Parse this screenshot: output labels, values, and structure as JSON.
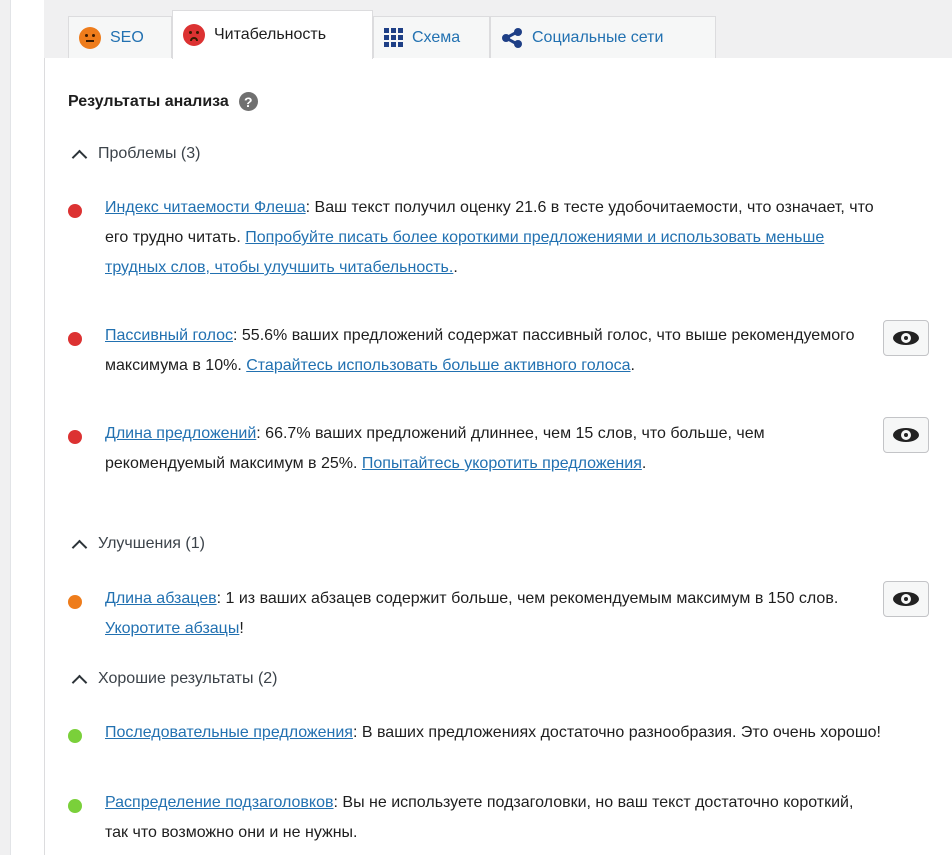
{
  "tabs": [
    {
      "label": "SEO",
      "icon": "orange-face-icon"
    },
    {
      "label": "Читабельность",
      "icon": "sad-red-face-icon"
    },
    {
      "label": "Схема",
      "icon": "grid-icon"
    },
    {
      "label": "Социальные сети",
      "icon": "share-icon"
    }
  ],
  "analysis": {
    "heading": "Результаты анализа",
    "help_icon": "?",
    "groups": {
      "problems": {
        "title": "Проблемы (3)",
        "items": [
          {
            "link": "Индекс читаемости Флеша",
            "text1": ": Ваш текст получил оценку 21.6 в тесте удобочитаемости, что означает, что его трудно читать. ",
            "link2": "Попробуйте писать более короткими предложениями и использовать меньше трудных слов, чтобы улучшить читабельность.",
            "text2": "."
          },
          {
            "link": "Пассивный голос",
            "text1": ": 55.6% ваших предложений содержат пассивный голос, что выше рекомендуемого максимума в 10%. ",
            "link2": "Старайтесь использовать больше активного голоса",
            "text2": "."
          },
          {
            "link": "Длина предложений",
            "text1": ": 66.7% ваших предложений длиннее, чем 15 слов, что больше, чем рекомендуемый максимум в 25%. ",
            "link2": "Попытайтесь укоротить предложения",
            "text2": "."
          }
        ]
      },
      "improvements": {
        "title": "Улучшения (1)",
        "items": [
          {
            "link": "Длина абзацев",
            "text1": ": 1 из ваших абзацев содержит больше, чем рекомендуемым максимум в 150 слов. ",
            "link2": "Укоротите абзацы",
            "text2": "!"
          }
        ]
      },
      "good": {
        "title": "Хорошие результаты (2)",
        "items": [
          {
            "link": "Последовательные предложения",
            "text1": ": В ваших предложениях достаточно разнообразия. Это очень хорошо!"
          },
          {
            "link": "Распределение подзаголовков",
            "text1": ": Вы не используете подзаголовки, но ваш текст достаточно короткий, так что возможно они и не нужны."
          }
        ]
      }
    }
  },
  "colors": {
    "problem": "#dc3232",
    "improvement": "#ee7c1b",
    "good": "#7ad03a",
    "link": "#2271b1"
  }
}
